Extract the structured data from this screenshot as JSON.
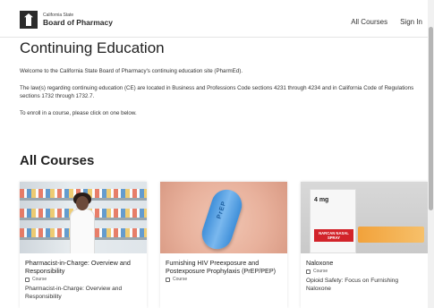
{
  "header": {
    "logo_small": "California State",
    "logo_big": "Board of Pharmacy",
    "nav": [
      "All Courses",
      "Sign In"
    ]
  },
  "main": {
    "title": "Continuing Education",
    "paragraphs": [
      "Welcome to the California State Board of Pharmacy's continuing education site (PharmEd).",
      "The law(s) regarding continuing education (CE) are located in Business and Professions Code sections 4231 through 4234 and in California Code of Regulations sections 1732 through 1732.7.",
      "To enroll in a course, please click on one below."
    ]
  },
  "courses_section": {
    "title": "All Courses",
    "cards": [
      {
        "title": "Pharmacist-in-Charge: Overview and Responsibility",
        "badge": "Course",
        "description": "Pharmacist-in-Charge: Overview and Responsibility"
      },
      {
        "title": "Furnishing HIV Preexposure and Postexposure Prophylaxis (PrEP/PEP)",
        "badge": "Course",
        "description": "",
        "image_text": "PrEP"
      },
      {
        "title": "Naloxone",
        "badge": "Course",
        "description": "Opioid Safety: Focus on Furnishing Naloxone",
        "image_text_top": "4 mg",
        "image_text_label": "NARCAN NASAL SPRAY"
      }
    ]
  }
}
